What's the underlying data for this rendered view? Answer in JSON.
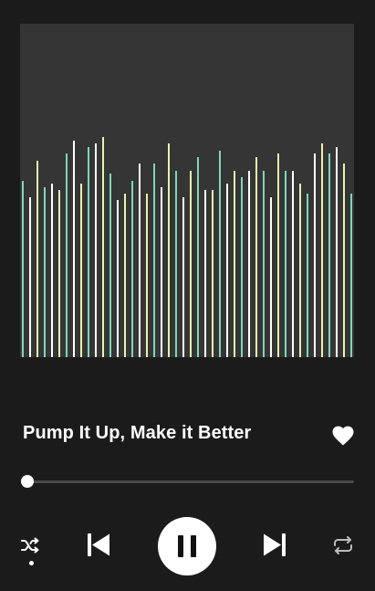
{
  "player": {
    "track_title": "Pump It Up, Make it Better",
    "liked": true,
    "progress_fraction": 0.02,
    "playing": true,
    "shuffle_active": true
  },
  "visualizer": {
    "levels": [
      0.53,
      0.48,
      0.59,
      0.51,
      0.52,
      0.5,
      0.61,
      0.65,
      0.52,
      0.63,
      0.64,
      0.66,
      0.55,
      0.47,
      0.49,
      0.53,
      0.58,
      0.49,
      0.58,
      0.51,
      0.64,
      0.56,
      0.48,
      0.56,
      0.6,
      0.5,
      0.5,
      0.62,
      0.52,
      0.56,
      0.54,
      0.56,
      0.6,
      0.56,
      0.48,
      0.61,
      0.56,
      0.56,
      0.52,
      0.49,
      0.61,
      0.64,
      0.61,
      0.63,
      0.58,
      0.49
    ],
    "colors": [
      "#7fd6b8",
      "#ffffff",
      "#e6f4b0"
    ]
  },
  "controls": {
    "shuffle_icon": "shuffle-icon",
    "previous_icon": "skip-previous-icon",
    "play_pause_icon": "pause-icon",
    "next_icon": "skip-next-icon",
    "repeat_icon": "repeat-icon",
    "like_icon": "heart-icon"
  },
  "theme": {
    "background": "#1b1b1b",
    "panel": "#353535",
    "foreground": "#ffffff",
    "inactive": "#bdbdbd"
  }
}
